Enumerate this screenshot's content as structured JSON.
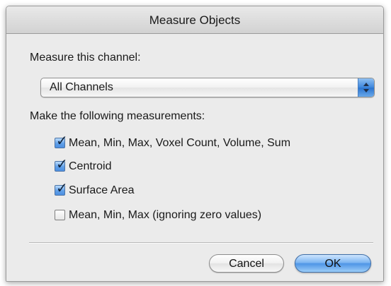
{
  "window": {
    "title": "Measure Objects"
  },
  "channel": {
    "label": "Measure this channel:",
    "selected": "All Channels"
  },
  "measurements": {
    "label": "Make the following measurements:",
    "options": [
      {
        "label": "Mean, Min, Max, Voxel Count, Volume, Sum",
        "checked": true
      },
      {
        "label": "Centroid",
        "checked": true
      },
      {
        "label": "Surface Area",
        "checked": true
      },
      {
        "label": "Mean, Min, Max (ignoring zero values)",
        "checked": false
      }
    ]
  },
  "buttons": {
    "cancel": "Cancel",
    "ok": "OK"
  },
  "colors": {
    "accent": "#4f95e6"
  }
}
